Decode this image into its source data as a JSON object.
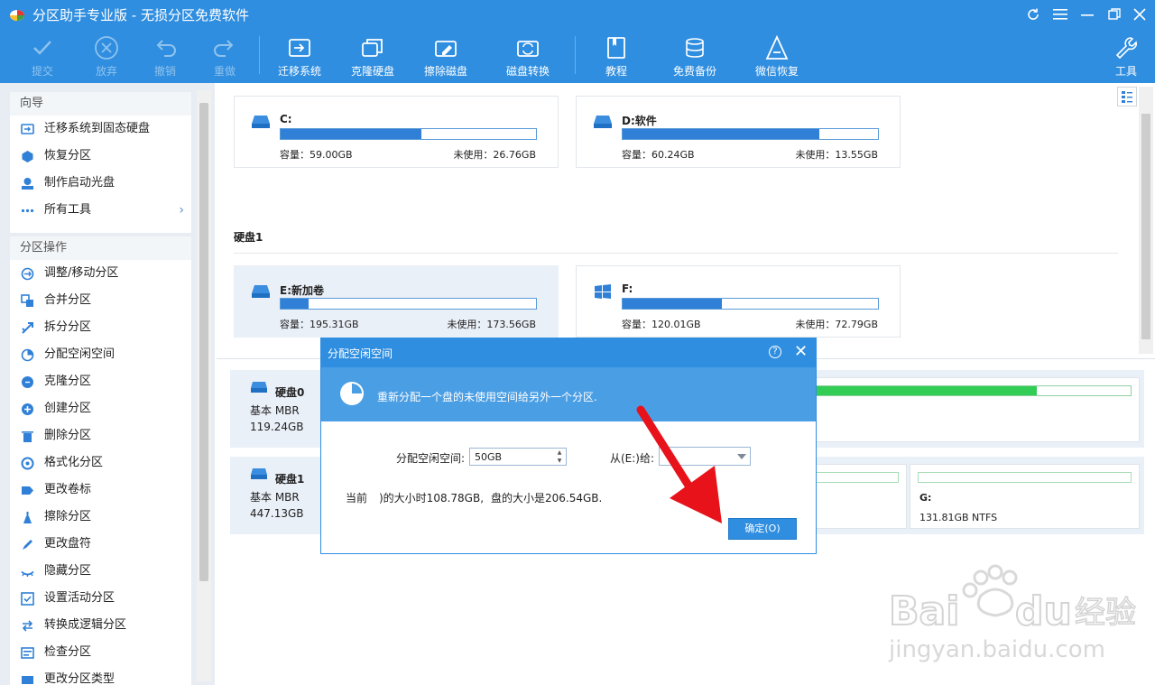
{
  "window": {
    "title": "分区助手专业版 - 无损分区免费软件",
    "controls": [
      "refresh-icon",
      "menu-icon",
      "minimize-icon",
      "restore-icon",
      "close-icon"
    ]
  },
  "toolbar": {
    "commit": "提交",
    "discard": "放弃",
    "undo": "撤销",
    "redo": "重做",
    "migrate_os": "迁移系统",
    "clone_disk": "克隆硬盘",
    "wipe_disk": "擦除磁盘",
    "disk_convert": "磁盘转换",
    "tutorial": "教程",
    "free_backup": "免费备份",
    "wechat_recovery": "微信恢复",
    "tools": "工具"
  },
  "sidebar": {
    "wizard_title": "向导",
    "wizard_items": [
      {
        "label": "迁移系统到固态硬盘",
        "icon": "migrate-icon"
      },
      {
        "label": "恢复分区",
        "icon": "recover-icon"
      },
      {
        "label": "制作启动光盘",
        "icon": "bootdisk-icon"
      },
      {
        "label": "所有工具",
        "icon": "more-icon"
      }
    ],
    "ops_title": "分区操作",
    "ops_items": [
      {
        "label": "调整/移动分区",
        "icon": "resize-icon"
      },
      {
        "label": "合并分区",
        "icon": "merge-icon"
      },
      {
        "label": "拆分分区",
        "icon": "split-icon"
      },
      {
        "label": "分配空闲空间",
        "icon": "allocate-icon"
      },
      {
        "label": "克隆分区",
        "icon": "clone-icon"
      },
      {
        "label": "创建分区",
        "icon": "create-icon"
      },
      {
        "label": "删除分区",
        "icon": "delete-icon"
      },
      {
        "label": "格式化分区",
        "icon": "format-icon"
      },
      {
        "label": "更改卷标",
        "icon": "label-icon"
      },
      {
        "label": "擦除分区",
        "icon": "wipe-icon"
      },
      {
        "label": "更改盘符",
        "icon": "letter-icon"
      },
      {
        "label": "隐藏分区",
        "icon": "hide-icon"
      },
      {
        "label": "设置活动分区",
        "icon": "active-icon"
      },
      {
        "label": "转换成逻辑分区",
        "icon": "convert-icon"
      },
      {
        "label": "检查分区",
        "icon": "check-icon"
      },
      {
        "label": "更改分区类型",
        "icon": "type-icon"
      }
    ]
  },
  "partitions": {
    "c": {
      "name": "C:",
      "capacity": "容量：59.00GB",
      "free": "未使用：26.76GB",
      "used_fraction": 0.55
    },
    "d": {
      "name": "D:软件",
      "capacity": "容量：60.24GB",
      "free": "未使用：13.55GB",
      "used_fraction": 0.77
    },
    "disk1_label": "硬盘1",
    "e": {
      "name": "E:新加卷",
      "capacity": "容量：195.31GB",
      "free": "未使用：173.56GB",
      "used_fraction": 0.11
    },
    "f": {
      "name": "F:",
      "capacity": "容量：120.01GB",
      "free": "未使用：72.79GB",
      "used_fraction": 0.39
    }
  },
  "disks": [
    {
      "name": "硬盘0",
      "type": "基本 MBR",
      "size": "119.24GB"
    },
    {
      "name": "硬盘1",
      "type": "基本 MBR",
      "size": "447.13GB"
    }
  ],
  "disk1_segment_g": {
    "label": "G:",
    "info": "131.81GB NTFS"
  },
  "dialog": {
    "title": "分配空闲空间",
    "help": "?",
    "close": "✕",
    "description": "重新分配一个盘的未使用空间给另外一个分区.",
    "allocate_label": "分配空闲空间:",
    "allocate_value": "50GB",
    "from_label": "从(E:)给:",
    "info_prefix": "当前",
    "info_middle": ")的大小时108.78GB,",
    "info_suffix": "盘的大小是206.54GB.",
    "ok": "确定(O)"
  },
  "colors": {
    "brand": "#2f8ee0",
    "bar_fill": "#2f80d6",
    "disk0_bar": "#33cc55",
    "arrow": "#e8121b"
  }
}
